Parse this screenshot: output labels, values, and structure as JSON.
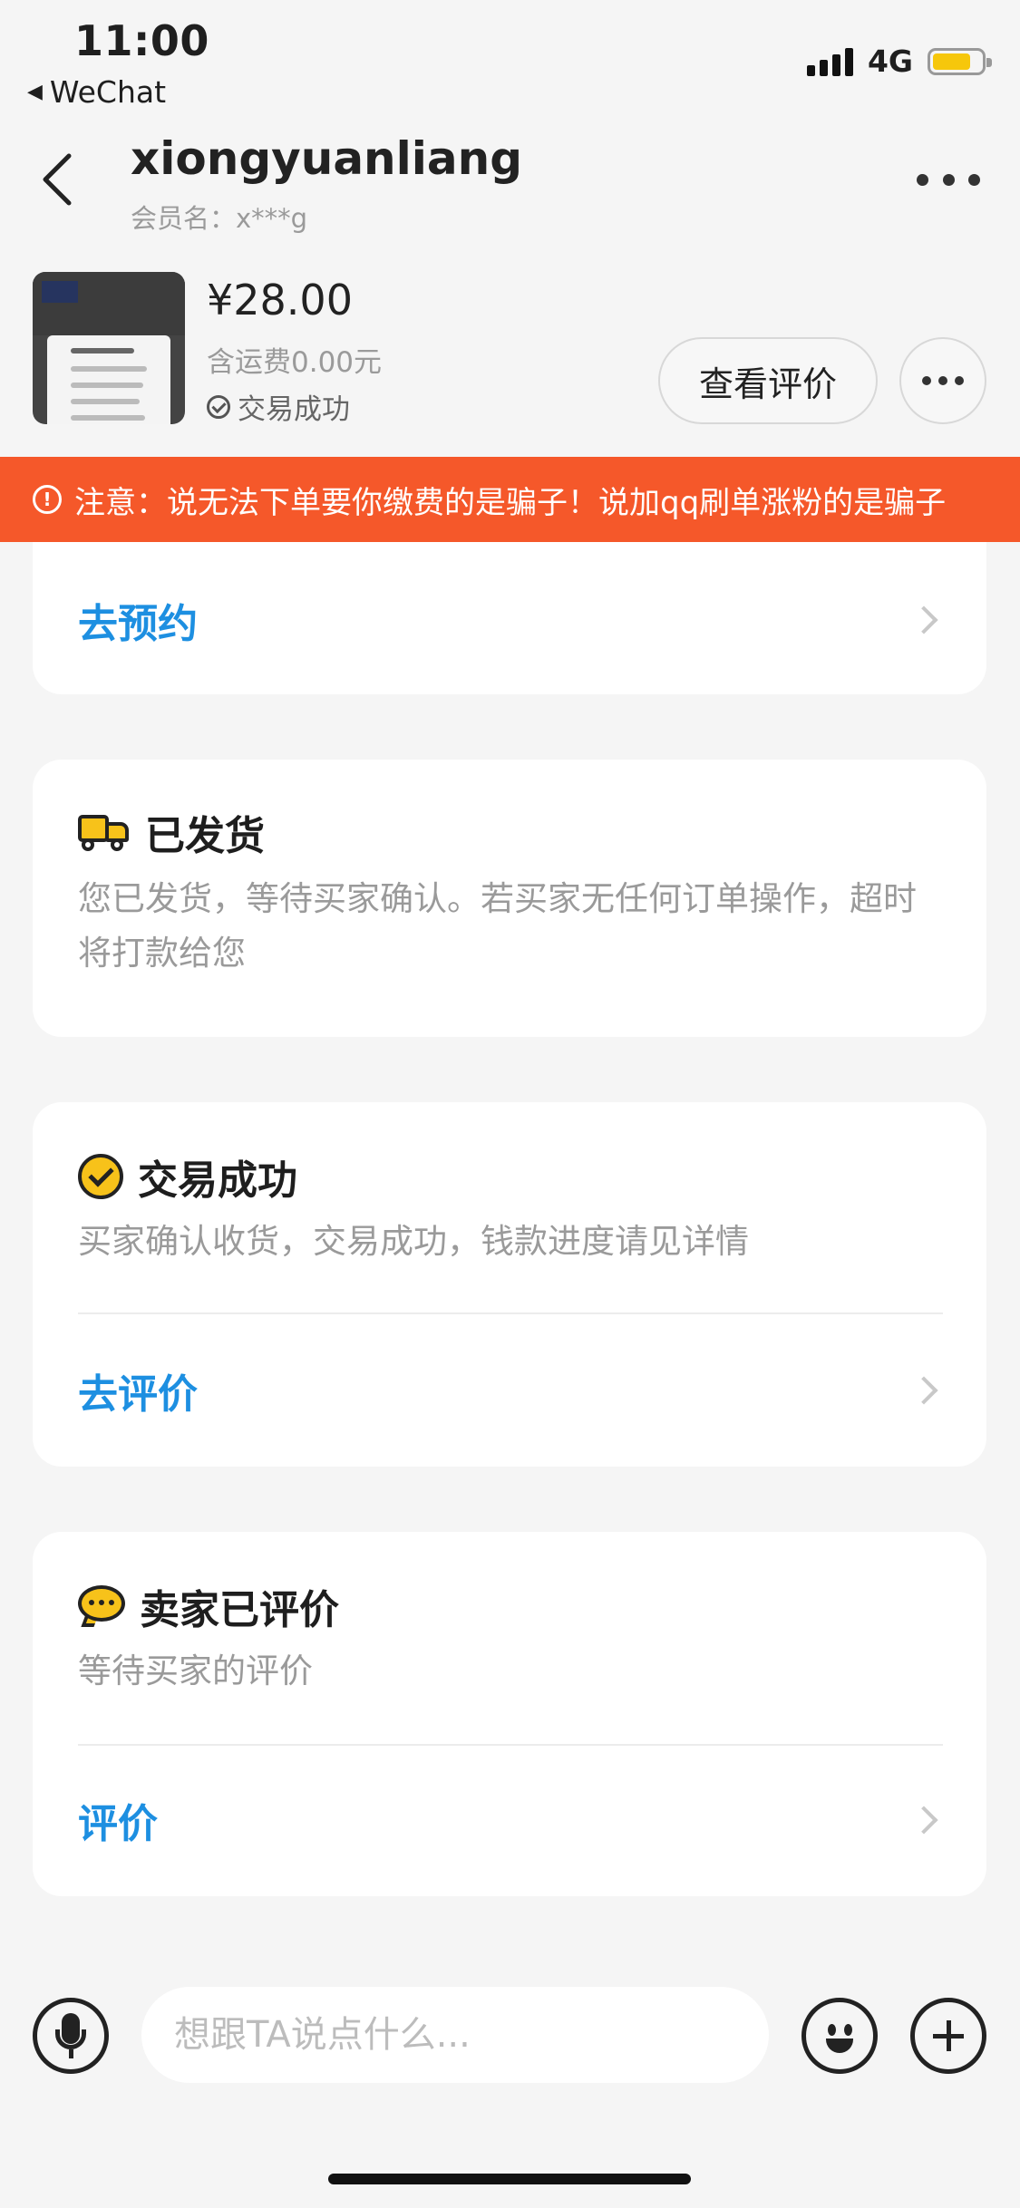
{
  "status_bar": {
    "time": "11:00",
    "back_app": "WeChat",
    "network": "4G"
  },
  "header": {
    "username": "xiongyuanliang",
    "member_label": "会员名：x***g"
  },
  "product": {
    "price": "¥28.00",
    "shipping": "含运费0.00元",
    "trade_status": "交易成功",
    "review_button": "查看评价"
  },
  "warning": {
    "text": "注意：说无法下单要你缴费的是骗子！说加qq刷单涨粉的是骗子"
  },
  "cards": {
    "appointment": {
      "action": "去预约"
    },
    "shipped": {
      "title": "已发货",
      "desc": "您已发货，等待买家确认。若买家无任何订单操作，超时将打款给您"
    },
    "success": {
      "title": "交易成功",
      "desc": "买家确认收货，交易成功，钱款进度请见详情",
      "action": "去评价"
    },
    "reviewed": {
      "title": "卖家已评价",
      "desc": "等待买家的评价",
      "action": "评价"
    }
  },
  "input_bar": {
    "placeholder": "想跟TA说点什么..."
  },
  "colors": {
    "warning_bg": "#f5582a",
    "link": "#1d8fe1",
    "icon_yellow": "#f7c21a"
  }
}
